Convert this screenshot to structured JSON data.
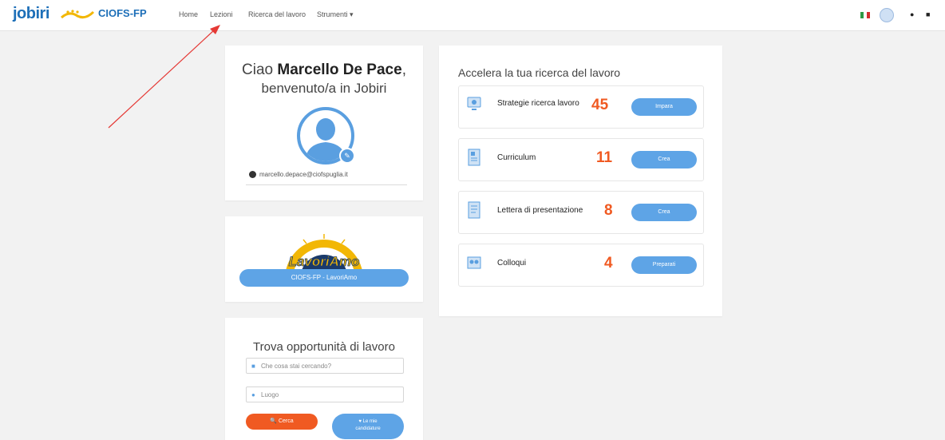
{
  "nav": {
    "brand_jobiri": "jobiri",
    "brand_ciofs": "CIOFS-FP",
    "links": [
      "Home",
      "Lezioni",
      "Ricerca del lavoro",
      "Strumenti ▾"
    ]
  },
  "welcome": {
    "greeting": "Ciao ",
    "name": "Marcello De Pace",
    "comma": ",",
    "subtitle": "benvenuto/a in Jobiri",
    "email": "marcello.depace@ciofspuglia.it"
  },
  "lavoriamo": {
    "logo_text": "LavoriAmo",
    "button": "CIOFS-FP - LavoriAmo"
  },
  "search": {
    "title": "Trova opportunità di lavoro",
    "what_placeholder": "Che cosa stai cercando?",
    "where_placeholder": "Luogo",
    "search_button": "🔍 Cerca",
    "applications_button_line1": "♥ Le mie",
    "applications_button_line2": "candidature"
  },
  "accelera": {
    "title": "Accelera la tua ricerca del lavoro",
    "items": [
      {
        "label": "Strategie ricerca lavoro",
        "count": "45",
        "button": "Impara",
        "icon": "strategy-icon"
      },
      {
        "label": "Curriculum",
        "count": "11",
        "button": "Crea",
        "icon": "cv-icon"
      },
      {
        "label": "Lettera di presentazione",
        "count": "8",
        "button": "Crea",
        "icon": "letter-icon"
      },
      {
        "label": "Colloqui",
        "count": "4",
        "button": "Preparati",
        "icon": "interview-icon"
      }
    ]
  },
  "colors": {
    "accent_blue": "#5ea4e6",
    "accent_orange": "#f05a22",
    "annotation_arrow": "#e53935"
  }
}
